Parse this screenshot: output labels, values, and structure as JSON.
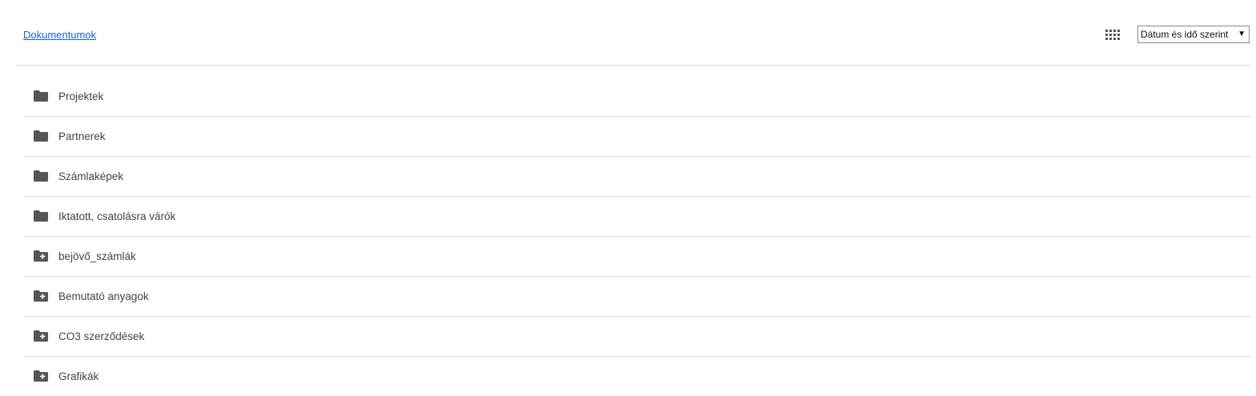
{
  "header": {
    "breadcrumb": "Dokumentumok",
    "view_toggle_icon": "grid-view-icon",
    "sort": {
      "selected": "Dátum és idő szerint",
      "arrow": "▼"
    }
  },
  "folders": [
    {
      "label": "Projektek",
      "icon": "folder-icon"
    },
    {
      "label": "Partnerek",
      "icon": "folder-icon"
    },
    {
      "label": "Számlaképek",
      "icon": "folder-icon"
    },
    {
      "label": "Iktatott, csatolásra várók",
      "icon": "folder-icon"
    },
    {
      "label": "bejövő_számlák",
      "icon": "folder-plus-icon"
    },
    {
      "label": "Bemutató anyagok",
      "icon": "folder-plus-icon"
    },
    {
      "label": "CO3 szerződések",
      "icon": "folder-plus-icon"
    },
    {
      "label": "Grafikák",
      "icon": "folder-plus-icon"
    }
  ],
  "colors": {
    "link": "#1a5fd6",
    "icon": "#555555",
    "text": "#444444",
    "divider": "#dcdcdc"
  }
}
